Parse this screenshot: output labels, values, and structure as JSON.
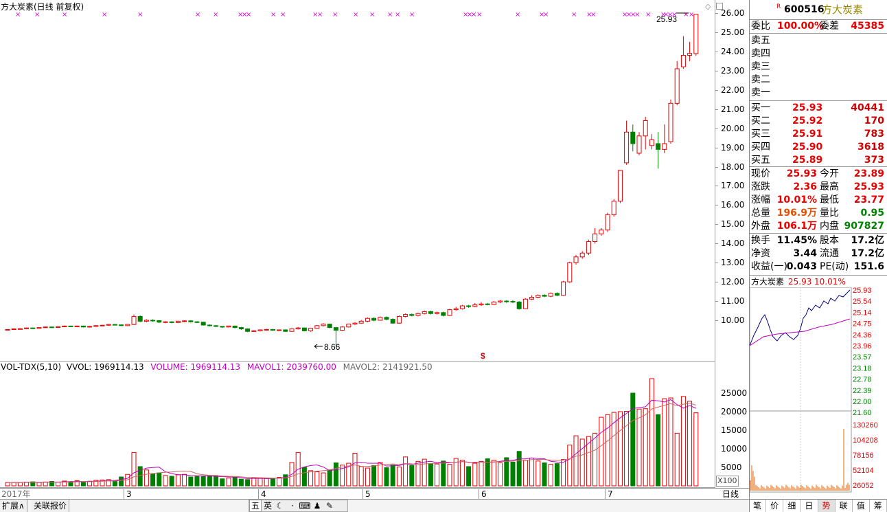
{
  "chart_title": "方大炭素(日线 前复权)",
  "price_axis_ticks": [
    "26.00",
    "25.00",
    "24.00",
    "23.00",
    "22.00",
    "21.00",
    "20.00",
    "19.00",
    "18.00",
    "17.00",
    "16.00",
    "15.00",
    "14.00",
    "13.00",
    "12.00",
    "11.00",
    "10.00"
  ],
  "volume_axis_ticks": [
    "25000",
    "20000",
    "15000",
    "10000",
    "5000"
  ],
  "volume_unit_label": "X100",
  "high_label": "25.93",
  "low_label": "8.66",
  "indicator_bar": {
    "name": "VOL-TDX(5,10)",
    "vvol": "VVOL: 1969114.13",
    "volume": "VOLUME: 1969114.13",
    "mavol1": "MAVOL1: 2039760.00",
    "mavol2": "MAVOL2: 2141921.50"
  },
  "time_axis": {
    "year": "2017年",
    "months": [
      "3",
      "4",
      "5",
      "6",
      "7"
    ],
    "period": "日线"
  },
  "bottom_buttons": {
    "expand": "扩展∧",
    "related": "关联报价"
  },
  "toolbar_icons": [
    "五",
    "英",
    "☾",
    "·",
    "⌨",
    "♟",
    "✎"
  ],
  "stock": {
    "code": "600516",
    "name": "方大炭素",
    "r_mark": "R"
  },
  "order_ratio": {
    "label": "委比",
    "value": "100.00%",
    "diff_label": "委差",
    "diff_value": "45385"
  },
  "sell_levels": [
    "卖五",
    "卖四",
    "卖三",
    "卖二",
    "卖一"
  ],
  "buy_levels": [
    {
      "label": "买一",
      "price": "25.93",
      "vol": "40441"
    },
    {
      "label": "买二",
      "price": "25.92",
      "vol": "170"
    },
    {
      "label": "买三",
      "price": "25.91",
      "vol": "783"
    },
    {
      "label": "买四",
      "price": "25.90",
      "vol": "3618"
    },
    {
      "label": "买五",
      "price": "25.89",
      "vol": "373"
    }
  ],
  "quote": [
    {
      "l1": "现价",
      "v1": "25.93",
      "l2": "今开",
      "v2": "23.89"
    },
    {
      "l1": "涨跌",
      "v1": "2.36",
      "l2": "最高",
      "v2": "25.93"
    },
    {
      "l1": "涨幅",
      "v1": "10.01%",
      "l2": "最低",
      "v2": "23.77"
    },
    {
      "l1": "总量",
      "v1": "196.9万",
      "l2": "量比",
      "v2": "0.95"
    },
    {
      "l1": "外盘",
      "v1": "106.1万",
      "l2": "内盘",
      "v2": "907827"
    }
  ],
  "fundamentals": [
    {
      "l1": "换手",
      "v1": "11.45%",
      "l2": "股本",
      "v2": "17.2亿"
    },
    {
      "l1": "净资",
      "v1": "3.44",
      "l2": "流通",
      "v2": "17.2亿"
    },
    {
      "l1": "收益(一)",
      "v1": "0.043",
      "l2": "PE(动)",
      "v2": "151.6"
    }
  ],
  "mini": {
    "name": "方大炭素",
    "price": "25.93",
    "pct": "10.01%",
    "price_ticks": [
      "25.93",
      "25.54",
      "25.14",
      "24.75",
      "24.36",
      "23.96",
      "23.57",
      "23.18",
      "22.78",
      "22.39",
      "22.00",
      "21.60"
    ],
    "vol_ticks": [
      "130260",
      "104208",
      "78156",
      "52104",
      "26052"
    ]
  },
  "tabs": [
    "笔",
    "价",
    "细",
    "日",
    "势",
    "联",
    "值",
    "筹"
  ],
  "active_tab": "势",
  "colors": {
    "up": "#e60000",
    "down": "#008000",
    "ma1": "#c000c0",
    "ma2": "#c000c0",
    "mini_line": "#000080"
  },
  "chart_data": {
    "type": "candlestick",
    "candles": [
      [
        9.5,
        9.52,
        9.48,
        9.53
      ],
      [
        9.52,
        9.55,
        9.5,
        9.57
      ],
      [
        9.55,
        9.56,
        9.52,
        9.58
      ],
      [
        9.56,
        9.6,
        9.54,
        9.62
      ],
      [
        9.6,
        9.58,
        9.55,
        9.62
      ],
      [
        9.58,
        9.62,
        9.56,
        9.64
      ],
      [
        9.62,
        9.65,
        9.6,
        9.67
      ],
      [
        9.65,
        9.63,
        9.6,
        9.67
      ],
      [
        9.63,
        9.66,
        9.61,
        9.68
      ],
      [
        9.66,
        9.7,
        9.64,
        9.72
      ],
      [
        9.7,
        9.68,
        9.65,
        9.72
      ],
      [
        9.68,
        9.7,
        9.65,
        9.72
      ],
      [
        9.7,
        9.65,
        9.62,
        9.72
      ],
      [
        9.65,
        9.68,
        9.62,
        9.7
      ],
      [
        9.68,
        9.72,
        9.66,
        9.75
      ],
      [
        9.72,
        9.74,
        9.7,
        9.76
      ],
      [
        9.74,
        9.78,
        9.72,
        9.8
      ],
      [
        9.78,
        9.76,
        9.73,
        9.8
      ],
      [
        9.76,
        9.72,
        9.7,
        9.78
      ],
      [
        9.72,
        9.78,
        9.7,
        9.8
      ],
      [
        9.78,
        10.2,
        9.75,
        10.3
      ],
      [
        10.2,
        9.95,
        9.9,
        10.25
      ],
      [
        9.95,
        10.0,
        9.9,
        10.05
      ],
      [
        10.0,
        9.98,
        9.92,
        10.05
      ],
      [
        9.98,
        9.9,
        9.85,
        10.0
      ],
      [
        9.9,
        9.92,
        9.85,
        9.95
      ],
      [
        9.92,
        9.88,
        9.84,
        9.95
      ],
      [
        9.88,
        9.95,
        9.85,
        9.98
      ],
      [
        9.95,
        9.97,
        9.9,
        10.0
      ],
      [
        9.97,
        9.92,
        9.88,
        10.0
      ],
      [
        9.92,
        9.9,
        9.86,
        9.95
      ],
      [
        9.9,
        9.75,
        9.72,
        9.92
      ],
      [
        9.75,
        9.72,
        9.68,
        9.78
      ],
      [
        9.72,
        9.68,
        9.64,
        9.75
      ],
      [
        9.68,
        9.65,
        9.6,
        9.7
      ],
      [
        9.65,
        9.7,
        9.62,
        9.72
      ],
      [
        9.7,
        9.62,
        9.58,
        9.72
      ],
      [
        9.62,
        9.55,
        9.5,
        9.65
      ],
      [
        9.55,
        9.42,
        9.38,
        9.58
      ],
      [
        9.42,
        9.45,
        9.4,
        9.48
      ],
      [
        9.45,
        9.5,
        9.42,
        9.52
      ],
      [
        9.5,
        9.52,
        9.46,
        9.55
      ],
      [
        9.52,
        9.48,
        9.45,
        9.55
      ],
      [
        9.48,
        9.5,
        9.45,
        9.52
      ],
      [
        9.5,
        9.42,
        9.4,
        9.52
      ],
      [
        9.42,
        9.55,
        9.4,
        9.58
      ],
      [
        9.55,
        9.6,
        9.52,
        9.65
      ],
      [
        9.6,
        9.45,
        9.42,
        9.62
      ],
      [
        9.45,
        9.58,
        9.4,
        9.6
      ],
      [
        9.58,
        9.72,
        9.55,
        9.75
      ],
      [
        9.72,
        9.8,
        9.68,
        9.85
      ],
      [
        9.8,
        9.62,
        9.58,
        9.82
      ],
      [
        9.62,
        9.48,
        8.66,
        9.65
      ],
      [
        9.48,
        9.65,
        9.45,
        9.68
      ],
      [
        9.65,
        9.8,
        9.62,
        9.82
      ],
      [
        9.8,
        9.85,
        9.76,
        9.9
      ],
      [
        9.85,
        9.95,
        9.82,
        10.0
      ],
      [
        9.95,
        10.1,
        9.9,
        10.15
      ],
      [
        10.1,
        10.0,
        9.95,
        10.15
      ],
      [
        10.0,
        10.15,
        9.98,
        10.2
      ],
      [
        10.15,
        10.05,
        10.0,
        10.2
      ],
      [
        10.05,
        9.85,
        9.82,
        10.1
      ],
      [
        9.85,
        10.2,
        9.82,
        10.25
      ],
      [
        10.2,
        10.3,
        10.15,
        10.35
      ],
      [
        10.3,
        10.25,
        10.2,
        10.35
      ],
      [
        10.25,
        10.35,
        10.2,
        10.4
      ],
      [
        10.35,
        10.45,
        10.3,
        10.5
      ],
      [
        10.45,
        10.35,
        10.3,
        10.5
      ],
      [
        10.35,
        10.4,
        10.3,
        10.45
      ],
      [
        10.4,
        10.25,
        10.2,
        10.45
      ],
      [
        10.25,
        10.55,
        10.22,
        10.6
      ],
      [
        10.55,
        10.6,
        10.5,
        10.7
      ],
      [
        10.6,
        10.75,
        10.55,
        10.8
      ],
      [
        10.75,
        10.72,
        10.65,
        10.8
      ],
      [
        10.72,
        10.8,
        10.68,
        10.9
      ],
      [
        10.8,
        10.85,
        10.75,
        10.95
      ],
      [
        10.85,
        10.82,
        10.78,
        10.9
      ],
      [
        10.82,
        10.95,
        10.8,
        11.0
      ],
      [
        10.95,
        11.0,
        10.9,
        11.05
      ],
      [
        11.0,
        10.98,
        10.9,
        11.05
      ],
      [
        10.98,
        10.95,
        10.9,
        11.05
      ],
      [
        10.95,
        10.6,
        10.55,
        11.0
      ],
      [
        10.6,
        11.1,
        10.58,
        11.15
      ],
      [
        11.1,
        11.2,
        11.05,
        11.3
      ],
      [
        11.2,
        11.3,
        11.15,
        11.35
      ],
      [
        11.3,
        11.25,
        11.2,
        11.35
      ],
      [
        11.25,
        11.4,
        11.2,
        11.45
      ],
      [
        11.4,
        11.3,
        11.25,
        11.45
      ],
      [
        11.3,
        12.0,
        11.28,
        12.05
      ],
      [
        12.0,
        13.0,
        11.95,
        13.05
      ],
      [
        13.0,
        13.3,
        12.9,
        13.4
      ],
      [
        13.3,
        13.5,
        13.2,
        13.6
      ],
      [
        13.5,
        14.1,
        13.4,
        14.2
      ],
      [
        14.1,
        14.5,
        14.0,
        14.8
      ],
      [
        14.5,
        14.7,
        14.4,
        14.8
      ],
      [
        14.7,
        15.5,
        14.6,
        15.6
      ],
      [
        15.5,
        16.2,
        15.4,
        16.3
      ],
      [
        16.2,
        17.8,
        16.1,
        17.8
      ],
      [
        18.2,
        19.8,
        18.1,
        20.4
      ],
      [
        19.8,
        19.2,
        18.8,
        20.2
      ],
      [
        18.7,
        19.6,
        18.6,
        19.8
      ],
      [
        19.6,
        20.4,
        18.9,
        20.6
      ],
      [
        19.1,
        19.4,
        18.9,
        19.7
      ],
      [
        19.2,
        18.9,
        17.9,
        19.8
      ],
      [
        18.9,
        19.2,
        18.7,
        20.2
      ],
      [
        19.3,
        21.3,
        19.2,
        21.5
      ],
      [
        21.3,
        23.1,
        21.2,
        23.5
      ],
      [
        23.2,
        23.8,
        23.1,
        24.8
      ],
      [
        23.8,
        23.9,
        23.5,
        24.5
      ],
      [
        23.89,
        25.93,
        23.77,
        25.93
      ]
    ],
    "volumes": [
      900,
      950,
      880,
      1000,
      1100,
      900,
      1050,
      1200,
      980,
      1300,
      1150,
      1400,
      1000,
      1250,
      1500,
      1600,
      1700,
      1400,
      2400,
      3100,
      9000,
      5200,
      4300,
      3200,
      3500,
      2800,
      2600,
      3000,
      3100,
      2400,
      2600,
      2500,
      2700,
      2800,
      1900,
      2100,
      2300,
      1800,
      1700,
      2200,
      2100,
      2000,
      1900,
      2300,
      3000,
      6300,
      9000,
      5000,
      4100,
      3800,
      3500,
      4300,
      6200,
      5600,
      6100,
      8800,
      5200,
      4800,
      5500,
      6300,
      4900,
      5600,
      5100,
      7800,
      5500,
      6600,
      7200,
      6000,
      5900,
      6700,
      5800,
      7400,
      6900,
      5200,
      6100,
      6600,
      7300,
      6900,
      6200,
      7600,
      6400,
      9300,
      6900,
      7500,
      6700,
      6200,
      5800,
      6000,
      7100,
      11000,
      13500,
      12600,
      13300,
      14200,
      18500,
      19200,
      19800,
      20000,
      20100,
      25000,
      20700,
      20800,
      28900,
      19200,
      23500,
      23700,
      14200,
      24100,
      22800,
      19700
    ]
  }
}
